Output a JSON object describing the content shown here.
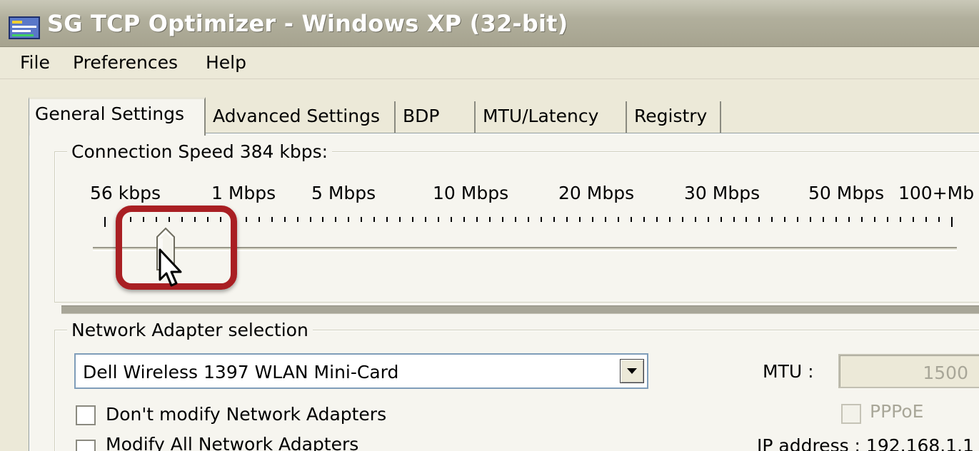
{
  "window": {
    "title": "SG TCP Optimizer - Windows XP (32-bit)",
    "icon": "app-icon"
  },
  "menu": {
    "items": [
      {
        "label": "File"
      },
      {
        "label": "Preferences"
      },
      {
        "label": "Help"
      }
    ]
  },
  "tabs": [
    {
      "label": "General Settings",
      "active": true
    },
    {
      "label": "Advanced Settings",
      "active": false
    },
    {
      "label": "BDP",
      "active": false
    },
    {
      "label": "MTU/Latency",
      "active": false
    },
    {
      "label": "Registry",
      "active": false
    }
  ],
  "connection_speed": {
    "legend": "Connection Speed  384 kbps:",
    "labels": [
      "56 kbps",
      "1 Mbps",
      "5 Mbps",
      "10 Mbps",
      "20 Mbps",
      "30 Mbps",
      "50 Mbps",
      "100+Mb"
    ],
    "selected": "384 kbps"
  },
  "network_adapter": {
    "legend": "Network Adapter selection",
    "selected_adapter": "Dell Wireless 1397 WLAN Mini-Card",
    "mtu_label": "MTU :",
    "mtu_value": "1500",
    "dont_modify_label": "Don't modify Network Adapters",
    "modify_all_label": "Modify All Network Adapters",
    "pppoe_label": "PPPoE",
    "ip_address_label": "IP address : 192.168.1.1"
  },
  "colors": {
    "highlight": "#a91f23",
    "background": "#ece9d8",
    "panel": "#f6f5ef"
  }
}
